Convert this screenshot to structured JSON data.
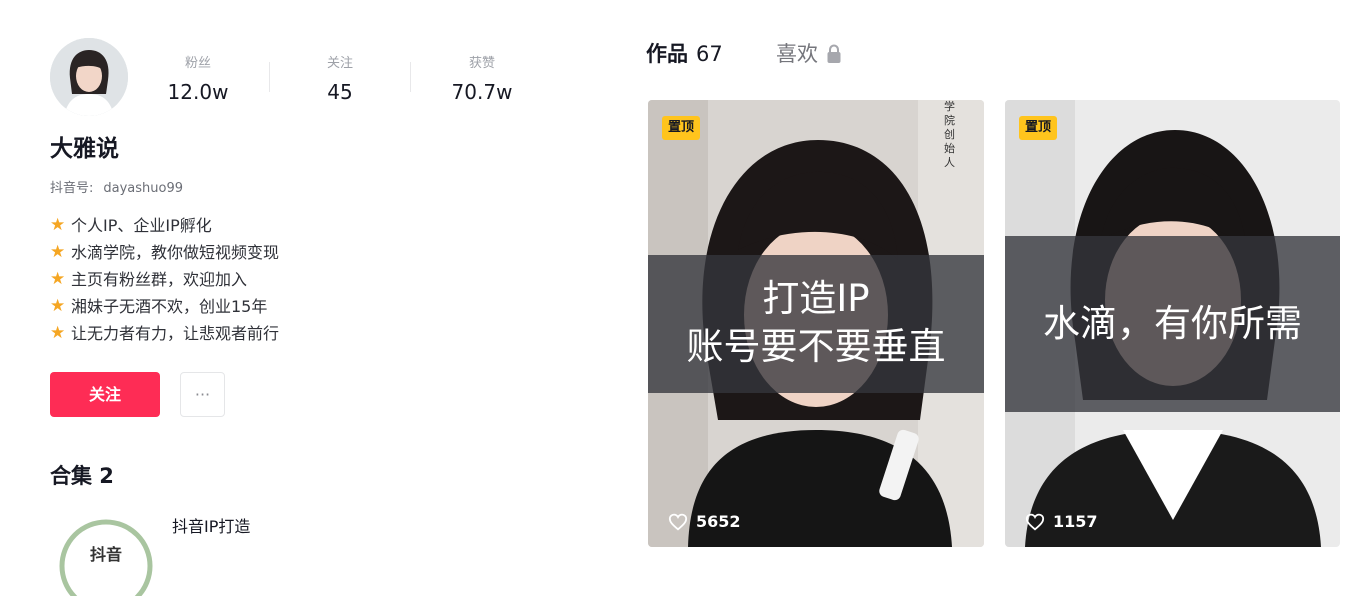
{
  "profile": {
    "name": "大雅说",
    "account_prefix": "抖音号:",
    "account_id": "dayashuo99",
    "stats": [
      {
        "label": "粉丝",
        "value": "12.0w"
      },
      {
        "label": "关注",
        "value": "45"
      },
      {
        "label": "获赞",
        "value": "70.7w"
      }
    ],
    "bio": [
      "个人IP、企业IP孵化",
      "水滴学院，教你做短视频变现",
      "主页有粉丝群，欢迎加入",
      "湘妹子无酒不欢，创业15年",
      "让无力者有力，让悲观者前行"
    ],
    "follow_label": "关注",
    "more_label": "···"
  },
  "collections": {
    "title": "合集 2",
    "items": [
      {
        "name": "抖音IP打造",
        "thumb_text": "抖音"
      }
    ]
  },
  "tabs": {
    "works_label": "作品",
    "works_count": "67",
    "likes_label": "喜欢"
  },
  "videos": [
    {
      "pinned_label": "置顶",
      "caption_line1": "打造IP",
      "caption_line2": "账号要不要垂直",
      "likes": "5652",
      "side_text": "学院创始人"
    },
    {
      "pinned_label": "置顶",
      "caption_line1": "水滴，有你所需",
      "likes": "1157"
    }
  ],
  "colors": {
    "accent": "#fe2c55",
    "pin_badge": "#ffc41d",
    "star": "#f5a623"
  }
}
